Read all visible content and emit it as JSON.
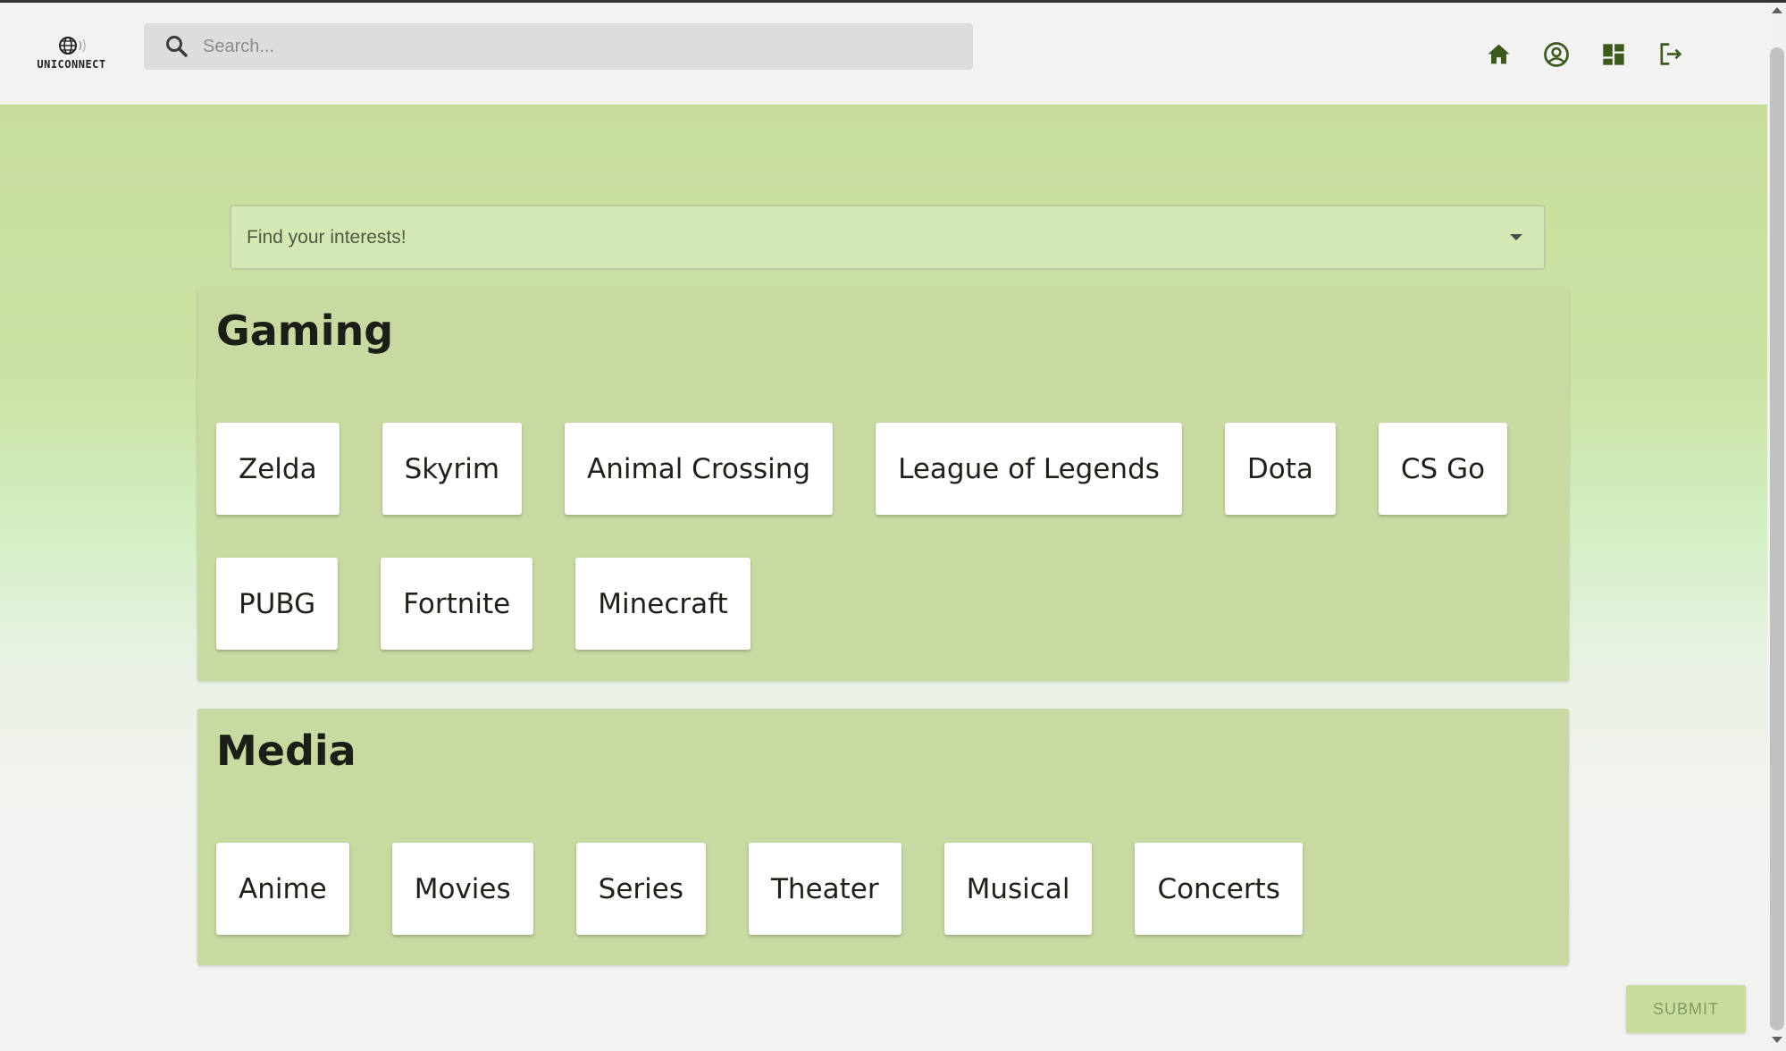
{
  "header": {
    "logo_text": "UNICONNECT",
    "search_placeholder": "Search...",
    "nav_icons": [
      "home-icon",
      "account-circle-icon",
      "dashboard-icon",
      "logout-icon"
    ]
  },
  "interests": {
    "select_placeholder": "Find your interests!"
  },
  "categories": [
    {
      "title": "Gaming",
      "items": [
        "Zelda",
        "Skyrim",
        "Animal Crossing",
        "League of Legends",
        "Dota",
        "CS Go",
        "PUBG",
        "Fortnite",
        "Minecraft"
      ]
    },
    {
      "title": "Media",
      "items": [
        "Anime",
        "Movies",
        "Series",
        "Theater",
        "Musical",
        "Concerts"
      ]
    }
  ],
  "submit_label": "SUBMIT",
  "colors": {
    "accent_dark": "#3d5a1e",
    "panel": "#c8d9a2",
    "background_top": "#c8dd9c"
  }
}
